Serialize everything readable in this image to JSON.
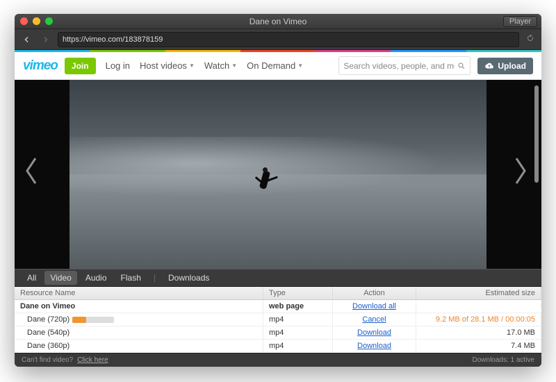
{
  "window": {
    "title": "Dane on Vimeo",
    "player_button": "Player"
  },
  "url": "https://vimeo.com/183878159",
  "color_strip": [
    "#1ab7ea",
    "#7ac800",
    "#f7b500",
    "#ef4123",
    "#d93a8f",
    "#2196f3",
    "#34c1c1"
  ],
  "vimeo": {
    "logo": "vimeo",
    "join": "Join",
    "nav": [
      {
        "label": "Log in",
        "caret": false
      },
      {
        "label": "Host videos",
        "caret": true
      },
      {
        "label": "Watch",
        "caret": true
      },
      {
        "label": "On Demand",
        "caret": true
      }
    ],
    "search_placeholder": "Search videos, people, and more",
    "upload": "Upload"
  },
  "filters": {
    "tabs": [
      "All",
      "Video",
      "Audio",
      "Flash"
    ],
    "active": 1,
    "divider": "|",
    "downloads_label": "Downloads"
  },
  "table": {
    "headers": {
      "name": "Resource Name",
      "type": "Type",
      "action": "Action",
      "size": "Estimated size"
    },
    "rows": [
      {
        "name": "Dane on Vimeo",
        "bold": true,
        "type": "web page",
        "type_bold": true,
        "action": "Download all",
        "size": "",
        "progress": false
      },
      {
        "name": "Dane (720p)",
        "type": "mp4",
        "action": "Cancel",
        "size": "9.2 MB of 28.1 MB / 00:00:05",
        "size_orange": true,
        "progress": true,
        "indent": true
      },
      {
        "name": "Dane (540p)",
        "type": "mp4",
        "action": "Download",
        "size": "17.0 MB",
        "indent": true
      },
      {
        "name": "Dane (360p)",
        "type": "mp4",
        "action": "Download",
        "size": "7.4 MB",
        "indent": true
      }
    ]
  },
  "status": {
    "help_text": "Can't find video?",
    "help_link": "Click here",
    "downloads": "Downloads: 1 active"
  }
}
